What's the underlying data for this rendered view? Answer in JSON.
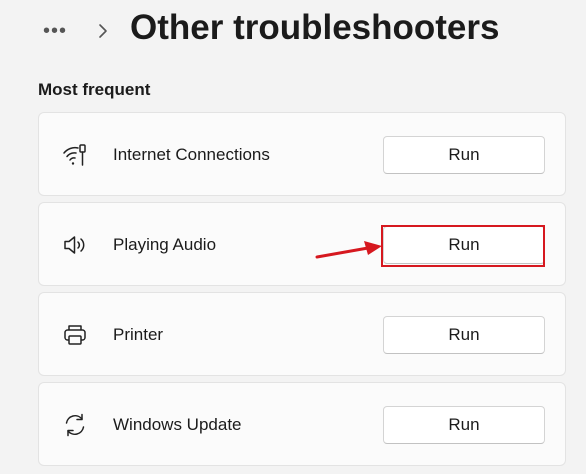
{
  "header": {
    "more_label": "•••",
    "title": "Other troubleshooters"
  },
  "section": {
    "title": "Most frequent"
  },
  "items": [
    {
      "label": "Internet Connections",
      "icon": "wifi-icon",
      "button": "Run"
    },
    {
      "label": "Playing Audio",
      "icon": "speaker-icon",
      "button": "Run"
    },
    {
      "label": "Printer",
      "icon": "printer-icon",
      "button": "Run"
    },
    {
      "label": "Windows Update",
      "icon": "sync-icon",
      "button": "Run"
    }
  ],
  "colors": {
    "annotation": "#d6181f",
    "background": "#f3f3f3",
    "card": "#fbfbfb"
  }
}
